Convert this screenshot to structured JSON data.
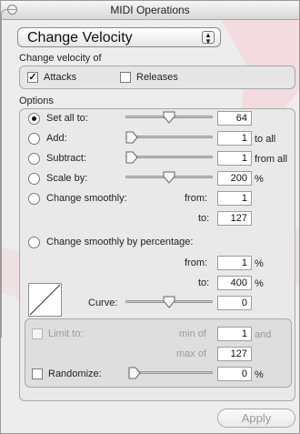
{
  "window": {
    "title": "MIDI Operations"
  },
  "popup": {
    "value": "Change Velocity"
  },
  "velocity_section": {
    "heading": "Change velocity of",
    "attacks": {
      "label": "Attacks",
      "checked": true
    },
    "releases": {
      "label": "Releases",
      "checked": false
    }
  },
  "options": {
    "heading": "Options",
    "set_all": {
      "label": "Set all to:",
      "value": "64",
      "selected": true,
      "slider_fraction": 0.5
    },
    "add": {
      "label": "Add:",
      "value": "1",
      "unit": "to all",
      "slider_fraction": 0.0
    },
    "subtract": {
      "label": "Subtract:",
      "value": "1",
      "unit": "from all",
      "slider_fraction": 0.0
    },
    "scale": {
      "label": "Scale by:",
      "value": "200",
      "unit": "%",
      "slider_fraction": 0.5
    },
    "smooth": {
      "label": "Change smoothly:",
      "from_label": "from:",
      "from_value": "1",
      "to_label": "to:",
      "to_value": "127"
    },
    "smooth_pct": {
      "label": "Change smoothly by percentage:",
      "from_label": "from:",
      "from_value": "1",
      "from_unit": "%",
      "to_label": "to:",
      "to_value": "400",
      "to_unit": "%"
    },
    "curve": {
      "label": "Curve:",
      "value": "0",
      "slider_fraction": 0.5
    }
  },
  "limit": {
    "label": "Limit to:",
    "min_label": "min of",
    "min_value": "1",
    "min_unit": "and",
    "max_label": "max of",
    "max_value": "127",
    "checked": false
  },
  "randomize": {
    "label": "Randomize:",
    "value": "0",
    "unit": "%",
    "checked": false,
    "slider_fraction": 0.0
  },
  "apply_button": {
    "label": "Apply"
  }
}
